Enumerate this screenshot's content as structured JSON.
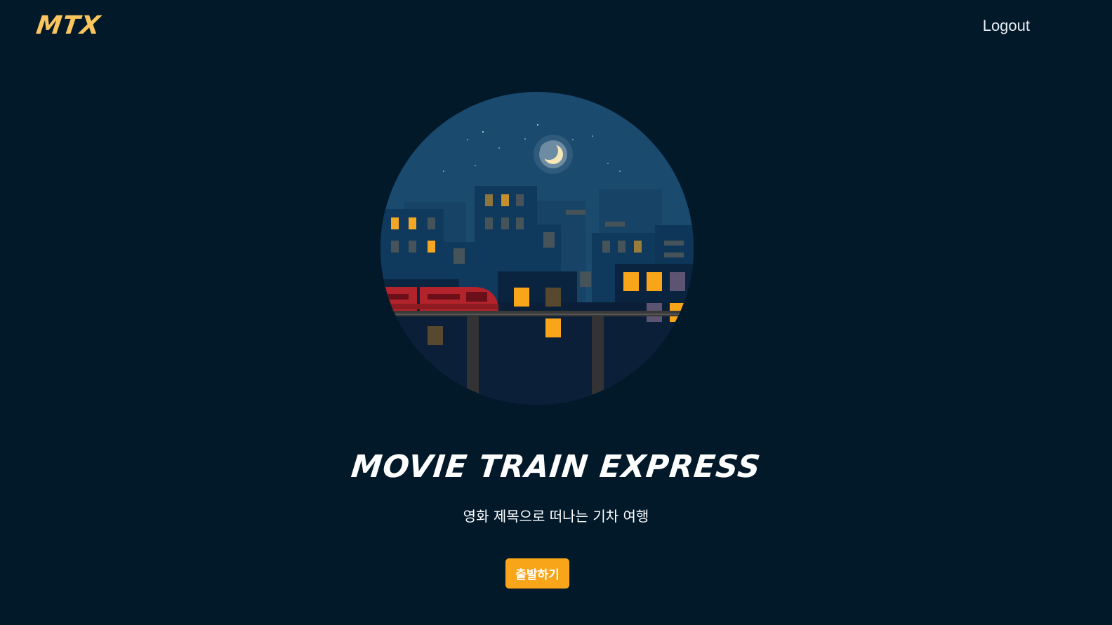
{
  "header": {
    "logo": "MTX",
    "logout_label": "Logout"
  },
  "hero": {
    "illustration": "night-city-train-illustration",
    "title": "MOVIE TRAIN EXPRESS",
    "subtitle": "영화 제목으로 떠나는 기차 여행",
    "start_label": "출발하기"
  },
  "colors": {
    "background": "#02192a",
    "accent": "#f9a51a",
    "logo": "#fbc55e",
    "sky": "#1a4a6e",
    "train": "#b3232b"
  }
}
